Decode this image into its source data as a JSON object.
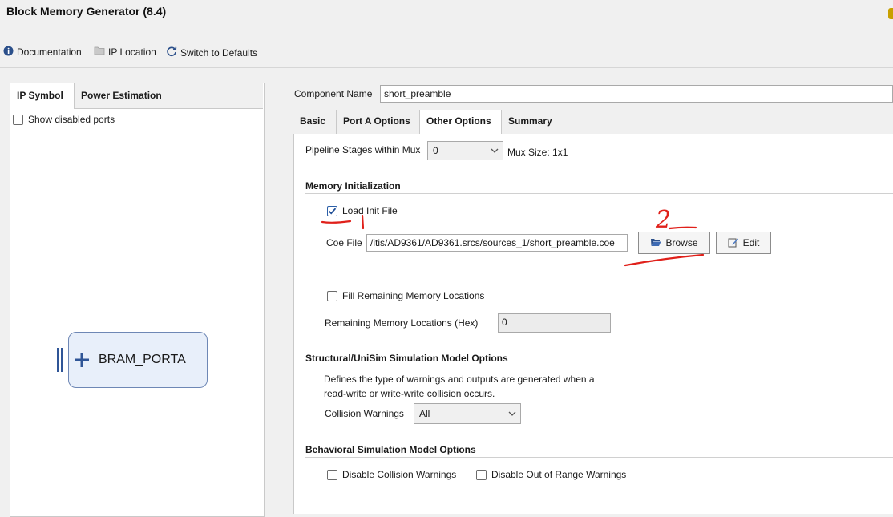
{
  "window": {
    "title": "Block Memory Generator (8.4)"
  },
  "toolbar": {
    "documentation": "Documentation",
    "ip_location": "IP Location",
    "switch_defaults": "Switch to Defaults"
  },
  "left_panel": {
    "tabs": [
      {
        "label": "IP Symbol",
        "active": true
      },
      {
        "label": "Power Estimation",
        "active": false
      }
    ],
    "show_disabled_ports": {
      "label": "Show disabled ports",
      "checked": false
    },
    "symbol": {
      "port_label": "BRAM_PORTA"
    }
  },
  "component": {
    "label": "Component Name",
    "value": "short_preamble"
  },
  "tabs": [
    {
      "label": "Basic",
      "active": false
    },
    {
      "label": "Port A Options",
      "active": false
    },
    {
      "label": "Other Options",
      "active": true
    },
    {
      "label": "Summary",
      "active": false
    }
  ],
  "pipeline": {
    "label": "Pipeline Stages within Mux",
    "value": "0",
    "mux_size": "Mux Size: 1x1"
  },
  "memory_init": {
    "title": "Memory Initialization",
    "load_init_file": {
      "label": "Load Init File",
      "checked": true
    },
    "coe_file": {
      "label": "Coe File",
      "value": "/itis/AD9361/AD9361.srcs/sources_1/short_preamble.coe"
    },
    "browse_label": "Browse",
    "edit_label": "Edit",
    "fill_remaining": {
      "label": "Fill Remaining Memory Locations",
      "checked": false
    },
    "remaining": {
      "label": "Remaining Memory Locations (Hex)",
      "value": "0"
    }
  },
  "structural": {
    "title": "Structural/UniSim Simulation Model Options",
    "desc_line1": "Defines the type of warnings and outputs are generated when a",
    "desc_line2": "read-write or write-write collision occurs.",
    "collision": {
      "label": "Collision Warnings",
      "value": "All"
    }
  },
  "behavioral": {
    "title": "Behavioral Simulation Model Options",
    "disable_collision": {
      "label": "Disable Collision Warnings",
      "checked": false
    },
    "disable_out_of_range": {
      "label": "Disable Out of Range Warnings",
      "checked": false
    }
  },
  "annotations": {
    "mark_2": "2"
  },
  "colors": {
    "accent": "#2b5fa8",
    "annotation": "#e0201a",
    "symbol_fill": "#e8effa"
  }
}
